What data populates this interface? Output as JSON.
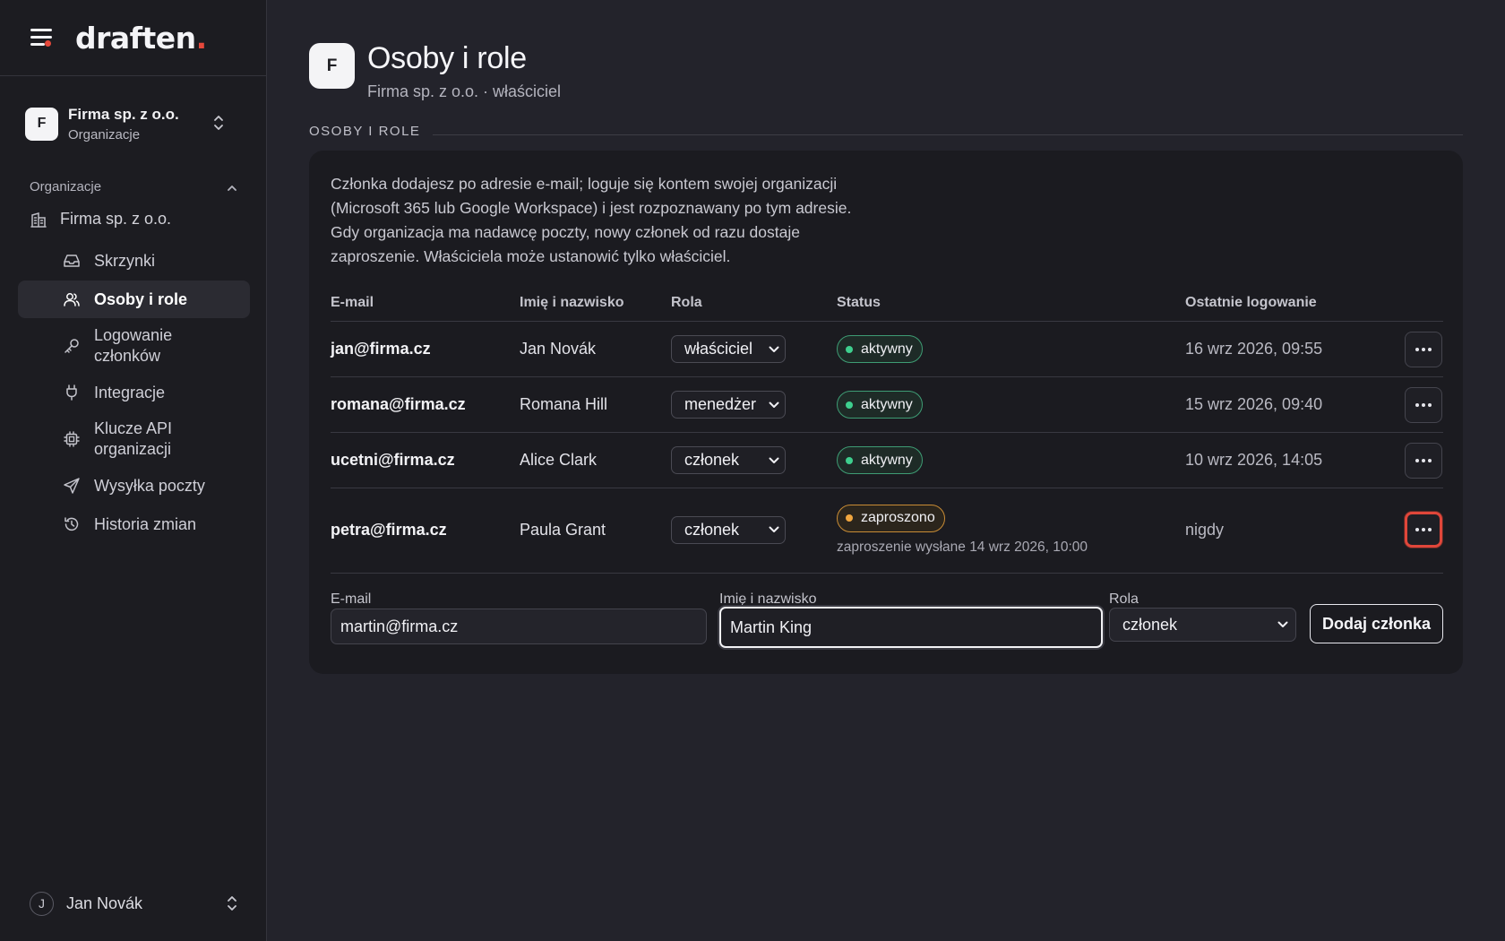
{
  "app": {
    "logo": "draften",
    "logo_dot": "."
  },
  "org_switcher": {
    "initial": "F",
    "name": "Firma sp. z o.o.",
    "subtitle": "Organizacje"
  },
  "sidebar": {
    "section_label": "Organizacje",
    "org_item": "Firma sp. z o.o.",
    "items": [
      {
        "label": "Skrzynki",
        "icon": "inbox-icon"
      },
      {
        "label": "Osoby i role",
        "icon": "users-icon",
        "active": true
      },
      {
        "label": "Logowanie członków",
        "icon": "key-icon"
      },
      {
        "label": "Integracje",
        "icon": "plug-icon"
      },
      {
        "label": "Klucze API organizacji",
        "icon": "chip-icon"
      },
      {
        "label": "Wysyłka poczty",
        "icon": "send-icon"
      },
      {
        "label": "Historia zmian",
        "icon": "history-icon"
      }
    ]
  },
  "user": {
    "initial": "J",
    "name": "Jan Novák"
  },
  "page": {
    "initial": "F",
    "title": "Osoby i role",
    "subtitle": "Firma sp. z o.o. · właściciel",
    "section": "OSOBY I ROLE",
    "intro": "Członka dodajesz po adresie e-mail; loguje się kontem swojej organizacji (Microsoft 365 lub Google Workspace) i jest rozpoznawany po tym adresie. Gdy organizacja ma nadawcę poczty, nowy członek od razu dostaje zaproszenie. Właściciela może ustanowić tylko właściciel."
  },
  "table": {
    "headers": {
      "email": "E-mail",
      "name": "Imię i nazwisko",
      "role": "Rola",
      "status": "Status",
      "last_login": "Ostatnie logowanie"
    },
    "rows": [
      {
        "email": "jan@firma.cz",
        "name": "Jan Novák",
        "role": "właściciel",
        "status": "aktywny",
        "last_login": "16 wrz 2026, 09:55"
      },
      {
        "email": "romana@firma.cz",
        "name": "Romana Hill",
        "role": "menedżer",
        "status": "aktywny",
        "last_login": "15 wrz 2026, 09:40"
      },
      {
        "email": "ucetni@firma.cz",
        "name": "Alice Clark",
        "role": "członek",
        "status": "aktywny",
        "last_login": "10 wrz 2026, 14:05"
      },
      {
        "email": "petra@firma.cz",
        "name": "Paula Grant",
        "role": "członek",
        "status": "zaproszono",
        "note": "zaproszenie wysłane 14 wrz 2026, 10:00",
        "last_login": "nigdy"
      }
    ]
  },
  "form": {
    "email_label": "E-mail",
    "email_value": "martin@firma.cz",
    "name_label": "Imię i nazwisko",
    "name_value": "Martin King",
    "role_label": "Rola",
    "role_value": "członek",
    "submit": "Dodaj członka"
  },
  "colors": {
    "accent": "#e5483b",
    "active_status": "#3ecf8e",
    "pending_status": "#f0a63f"
  }
}
